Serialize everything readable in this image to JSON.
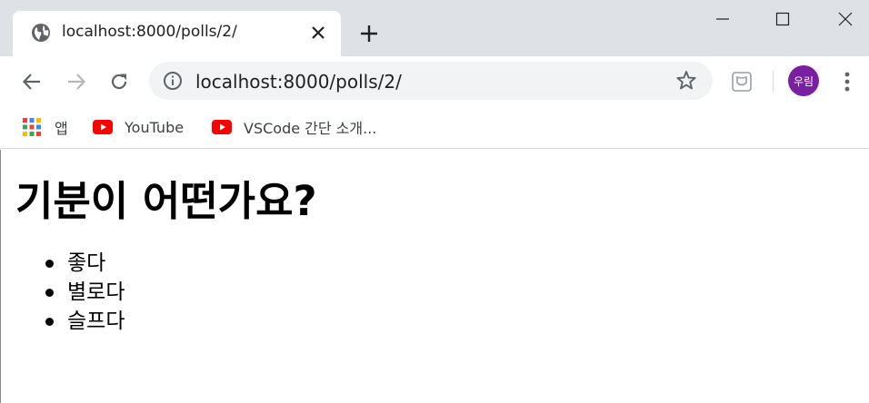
{
  "window": {
    "colors": {
      "tabstrip": "#dee1e6",
      "toolbar": "#ffffff",
      "omnibox": "#f1f3f4",
      "avatar": "#7b1fa2",
      "youtube_red": "#ff0000"
    },
    "controls": [
      "minimize-icon",
      "maximize-icon",
      "close-icon"
    ]
  },
  "tab": {
    "title": "localhost:8000/polls/2/",
    "favicon": "globe-icon"
  },
  "toolbar": {
    "url": "localhost:8000/polls/2/",
    "profile_initials": "우림"
  },
  "bookmarks": [
    {
      "label": "앱",
      "icon": "apps-grid-icon"
    },
    {
      "label": "YouTube",
      "icon": "youtube-icon"
    },
    {
      "label": "VSCode 간단 소개...",
      "icon": "youtube-icon"
    }
  ],
  "page": {
    "title": "기분이 어떤가요?",
    "choices": [
      "좋다",
      "별로다",
      "슬프다"
    ]
  }
}
